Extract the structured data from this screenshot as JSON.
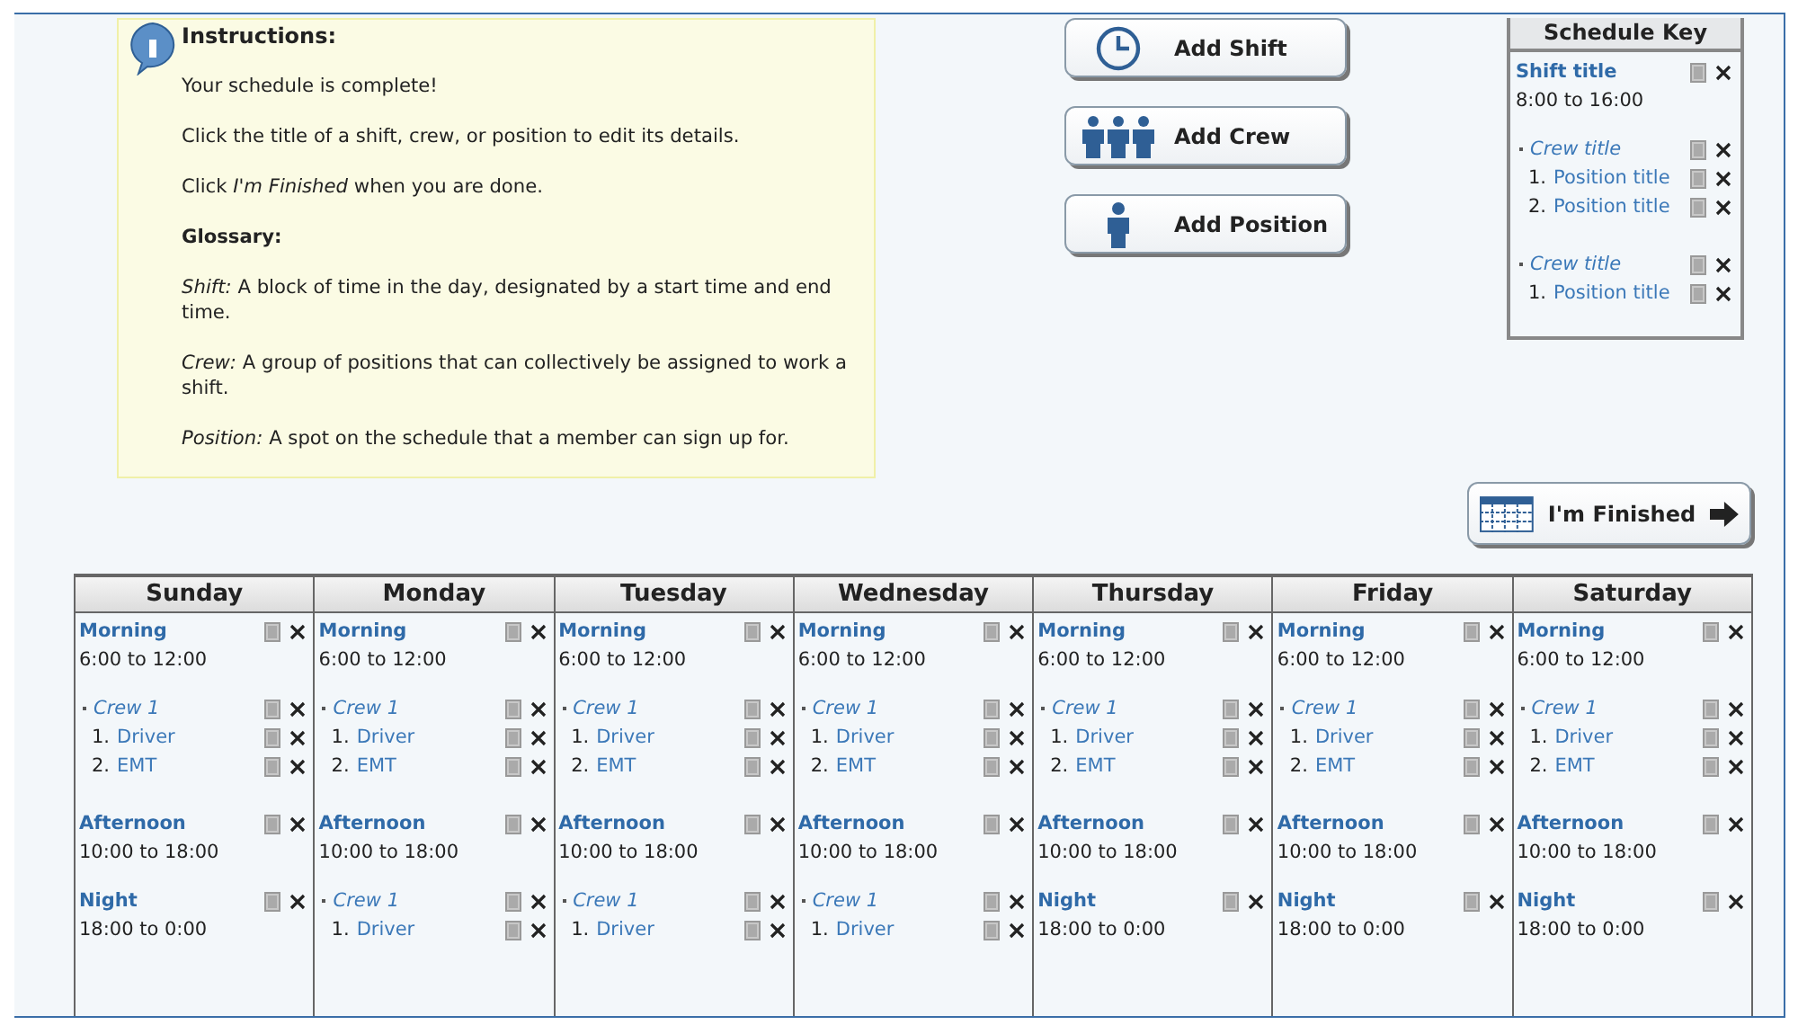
{
  "instructions": {
    "heading": "Instructions:",
    "paragraphs": [
      "Your schedule is complete!",
      "Click the title of a shift, crew, or position to edit its details.",
      "Click *I'm Finished* when you are done."
    ],
    "glossary_heading": "Glossary:",
    "glossary": [
      "*Shift:* A block of time in the day, designated by a start time and end time.",
      "*Crew:* A group of positions that can collectively be assigned to work a shift.",
      "*Position:* A spot on the schedule that a member can sign up for."
    ]
  },
  "buttons": [
    {
      "kind": "shift",
      "label": "Add Shift"
    },
    {
      "kind": "crew",
      "label": "Add Crew"
    },
    {
      "kind": "position",
      "label": "Add Position"
    }
  ],
  "schedule_key": {
    "heading": "Schedule Key",
    "shift": {
      "title": "Shift title",
      "time": "8:00 to 16:00",
      "crews": [
        {
          "title": "Crew title",
          "positions": [
            {
              "number": "1.",
              "title": "Position title"
            },
            {
              "number": "2.",
              "title": "Position title"
            }
          ]
        },
        {
          "title": "Crew title",
          "positions": [
            {
              "number": "1.",
              "title": "Position title"
            }
          ]
        }
      ]
    }
  },
  "finish_button": {
    "label": "I'm Finished"
  },
  "days": [
    {
      "name": "Sunday",
      "shifts": [
        {
          "title": "Morning",
          "time": "6:00 to 12:00",
          "crews": [
            {
              "title": "Crew 1",
              "positions": [
                {
                  "number": "1.",
                  "title": "Driver"
                },
                {
                  "number": "2.",
                  "title": "EMT"
                }
              ]
            }
          ]
        },
        {
          "title": "Afternoon",
          "time": "10:00 to 18:00"
        },
        {
          "title": "Night",
          "time": "18:00 to 0:00"
        }
      ]
    },
    {
      "name": "Monday",
      "shifts": [
        {
          "title": "Morning",
          "time": "6:00 to 12:00",
          "crews": [
            {
              "title": "Crew 1",
              "positions": [
                {
                  "number": "1.",
                  "title": "Driver"
                },
                {
                  "number": "2.",
                  "title": "EMT"
                }
              ]
            }
          ]
        },
        {
          "title": "Afternoon",
          "time": "10:00 to 18:00",
          "crews": [
            {
              "title": "Crew 1",
              "positions": [
                {
                  "number": "1.",
                  "title": "Driver"
                }
              ]
            }
          ]
        }
      ]
    },
    {
      "name": "Tuesday",
      "shifts": [
        {
          "title": "Morning",
          "time": "6:00 to 12:00",
          "crews": [
            {
              "title": "Crew 1",
              "positions": [
                {
                  "number": "1.",
                  "title": "Driver"
                },
                {
                  "number": "2.",
                  "title": "EMT"
                }
              ]
            }
          ]
        },
        {
          "title": "Afternoon",
          "time": "10:00 to 18:00",
          "crews": [
            {
              "title": "Crew 1",
              "positions": [
                {
                  "number": "1.",
                  "title": "Driver"
                }
              ]
            }
          ]
        }
      ]
    },
    {
      "name": "Wednesday",
      "shifts": [
        {
          "title": "Morning",
          "time": "6:00 to 12:00",
          "crews": [
            {
              "title": "Crew 1",
              "positions": [
                {
                  "number": "1.",
                  "title": "Driver"
                },
                {
                  "number": "2.",
                  "title": "EMT"
                }
              ]
            }
          ]
        },
        {
          "title": "Afternoon",
          "time": "10:00 to 18:00",
          "crews": [
            {
              "title": "Crew 1",
              "positions": [
                {
                  "number": "1.",
                  "title": "Driver"
                }
              ]
            }
          ]
        }
      ]
    },
    {
      "name": "Thursday",
      "shifts": [
        {
          "title": "Morning",
          "time": "6:00 to 12:00",
          "crews": [
            {
              "title": "Crew 1",
              "positions": [
                {
                  "number": "1.",
                  "title": "Driver"
                },
                {
                  "number": "2.",
                  "title": "EMT"
                }
              ]
            }
          ]
        },
        {
          "title": "Afternoon",
          "time": "10:00 to 18:00"
        },
        {
          "title": "Night",
          "time": "18:00 to 0:00"
        }
      ]
    },
    {
      "name": "Friday",
      "shifts": [
        {
          "title": "Morning",
          "time": "6:00 to 12:00",
          "crews": [
            {
              "title": "Crew 1",
              "positions": [
                {
                  "number": "1.",
                  "title": "Driver"
                },
                {
                  "number": "2.",
                  "title": "EMT"
                }
              ]
            }
          ]
        },
        {
          "title": "Afternoon",
          "time": "10:00 to 18:00"
        },
        {
          "title": "Night",
          "time": "18:00 to 0:00"
        }
      ]
    },
    {
      "name": "Saturday",
      "shifts": [
        {
          "title": "Morning",
          "time": "6:00 to 12:00",
          "crews": [
            {
              "title": "Crew 1",
              "positions": [
                {
                  "number": "1.",
                  "title": "Driver"
                },
                {
                  "number": "2.",
                  "title": "EMT"
                }
              ]
            }
          ]
        },
        {
          "title": "Afternoon",
          "time": "10:00 to 18:00"
        },
        {
          "title": "Night",
          "time": "18:00 to 0:00"
        }
      ]
    }
  ]
}
